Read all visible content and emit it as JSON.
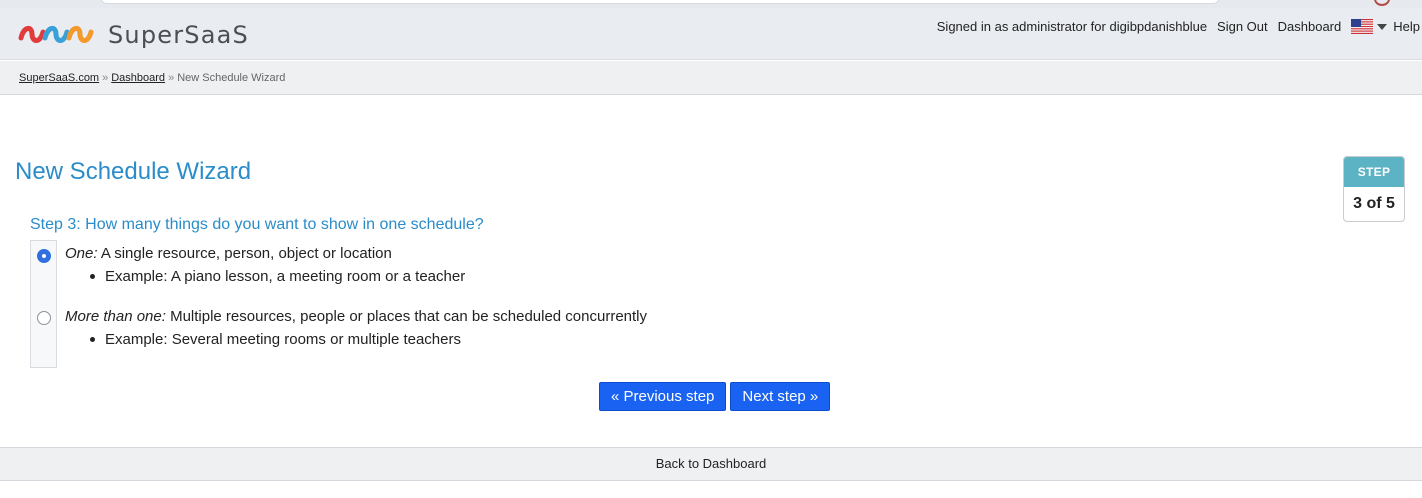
{
  "app": {
    "brand": "SuperSaaS",
    "logo_icon": "supersaas-logo"
  },
  "top_nav": {
    "signed_in": "Signed in as administrator for digibpdanishblue",
    "sign_out": "Sign Out",
    "dashboard": "Dashboard",
    "language_icon": "us-flag-icon",
    "help": "Help"
  },
  "breadcrumb": {
    "home": "SuperSaaS.com",
    "dashboard": "Dashboard",
    "current": "New Schedule Wizard",
    "separator": "»"
  },
  "main": {
    "title": "New Schedule Wizard",
    "step_label": "STEP",
    "step_value": "3 of 5",
    "question": "Step 3: How many things do you want to show in one schedule?",
    "options": [
      {
        "label": "One:",
        "description": " A single resource, person, object or location",
        "example": "Example: A piano lesson, a meeting room or a teacher",
        "selected": true
      },
      {
        "label": "More than one:",
        "description": " Multiple resources, people or places that can be scheduled concurrently",
        "example": "Example: Several meeting rooms or multiple teachers",
        "selected": false
      }
    ],
    "prev_button": "« Previous step",
    "next_button": "Next step »"
  },
  "footer": {
    "back_link": "Back to Dashboard"
  },
  "colors": {
    "accent": "#2a8cc9",
    "button": "#1a63f2",
    "step_badge": "#5bb3c4"
  }
}
